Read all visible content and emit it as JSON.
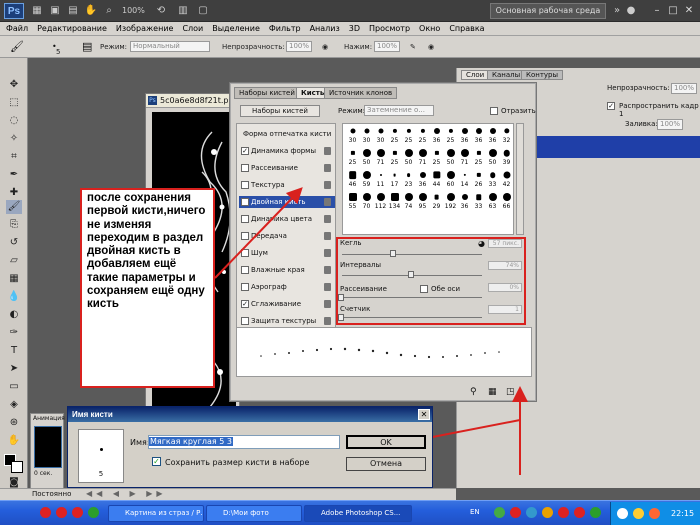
{
  "title_bar": {
    "logo": "Ps",
    "zoom": "100%",
    "workspace": "Основная рабочая среда"
  },
  "menu": [
    "Файл",
    "Редактирование",
    "Изображение",
    "Слои",
    "Выделение",
    "Фильтр",
    "Анализ",
    "3D",
    "Просмотр",
    "Окно",
    "Справка"
  ],
  "options_bar": {
    "brush_size": "5",
    "mode_label": "Режим:",
    "mode_value": "Нормальный",
    "opacity_label": "Непрозрачность:",
    "opacity_value": "100%",
    "pressure_label": "Нажим:",
    "pressure_value": "100%"
  },
  "document": {
    "title": "5c0a6e8d8f21t.p..."
  },
  "layers_panel": {
    "tabs": [
      "Слои",
      "Каналы",
      "Контуры"
    ],
    "opacity_label": "Непрозрачность:",
    "opacity_value": "100%",
    "unify_label": "Распространить кадр 1",
    "fill_label": "Заливка:",
    "fill_value": "100%"
  },
  "brush_panel": {
    "tabs": [
      "Наборы кистей",
      "Кисть",
      "Источник клонов"
    ],
    "presets_button": "Наборы кистей",
    "mode_label": "Режим:",
    "mode_value": "Затемнение о...",
    "flip_label": "Отразить",
    "list": [
      {
        "label": "Форма отпечатка кисти",
        "check": false,
        "header": true
      },
      {
        "label": "Динамика формы",
        "check": true
      },
      {
        "label": "Рассеивание",
        "check": false
      },
      {
        "label": "Текстура",
        "check": false
      },
      {
        "label": "Двойная кисть",
        "check": true,
        "active": true
      },
      {
        "label": "Динамика цвета",
        "check": false
      },
      {
        "label": "Передача",
        "check": false
      },
      {
        "label": "Шум",
        "check": false
      },
      {
        "label": "Влажные края",
        "check": false
      },
      {
        "label": "Аэрограф",
        "check": false
      },
      {
        "label": "Сглаживание",
        "check": true
      },
      {
        "label": "Защита текстуры",
        "check": false
      }
    ],
    "tips": [
      "30",
      "30",
      "30",
      "25",
      "25",
      "25",
      "36",
      "25",
      "36",
      "36",
      "36",
      "32",
      "25",
      "50",
      "71",
      "25",
      "50",
      "71",
      "25",
      "50",
      "71",
      "25",
      "50",
      "39",
      "46",
      "59",
      "11",
      "17",
      "23",
      "36",
      "44",
      "60",
      "14",
      "26",
      "33",
      "42",
      "55",
      "70",
      "112",
      "134",
      "74",
      "95",
      "29",
      "192",
      "36",
      "33",
      "63",
      "66"
    ],
    "settings": {
      "size_label": "Кегль",
      "size_value": "57 пикс.",
      "spacing_label": "Интервалы",
      "spacing_value": "74%",
      "scatter_label": "Рассеивание",
      "both_axes_label": "Обе оси",
      "scatter_value": "0%",
      "count_label": "Счетчик",
      "count_value": "1"
    }
  },
  "annotation": {
    "text": "после сохранения первой кисти,ничего не изменяя переходим в раздел двойная кисть в добавляем ещё такие параметры  и сохраняем ещё одну кисть"
  },
  "dialog": {
    "title": "Имя кисти",
    "preview_size": "5",
    "name_label": "Имя:",
    "name_value": "Мягкая круглая 5 3",
    "checkbox_label": "Сохранить размер кисти в наборе",
    "ok": "OK",
    "cancel": "Отмена"
  },
  "animation_panel": {
    "tab": "Анимация",
    "frame_time": "0 сек.",
    "loop": "Постоянно"
  },
  "taskbar": {
    "tasks": [
      "Картина из страз / Р...",
      "D:\\Мои фото",
      "Adobe Photoshop CS..."
    ],
    "lang": "EN",
    "clock": "22:15"
  }
}
